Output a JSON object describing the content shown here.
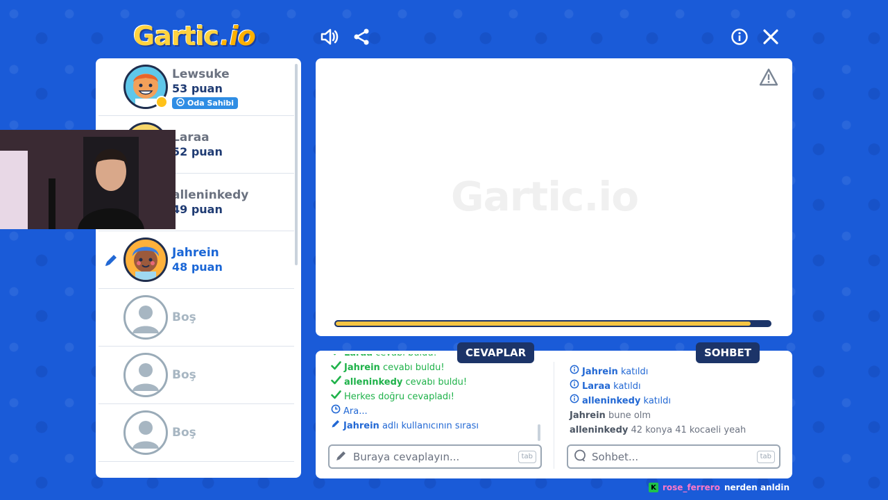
{
  "header": {
    "logo": "Gartic",
    "logo_suffix": ".io",
    "icons": [
      "sound-icon",
      "share-icon",
      "info-icon",
      "close-icon"
    ]
  },
  "players": [
    {
      "name": "Lewsuke",
      "points": "53 puan",
      "badge": "Oda Sahibi",
      "state": "owner"
    },
    {
      "name": "Laraa",
      "points": "52 puan",
      "state": "normal"
    },
    {
      "name": "alleninkedy",
      "points": "49 puan",
      "state": "normal"
    },
    {
      "name": "Jahrein",
      "points": "48 puan",
      "state": "drawing"
    },
    {
      "name": "Boş",
      "state": "empty"
    },
    {
      "name": "Boş",
      "state": "empty"
    },
    {
      "name": "Boş",
      "state": "empty"
    }
  ],
  "canvas": {
    "watermark": "Gartic.io",
    "timer_fraction": 0.955
  },
  "answers": {
    "title": "CEVAPLAR",
    "messages": [
      {
        "type": "ok",
        "user": "Laraa",
        "text": "cevabı buldu!"
      },
      {
        "type": "ok",
        "user": "Jahrein",
        "text": "cevabı buldu!"
      },
      {
        "type": "ok",
        "user": "alleninkedy",
        "text": "cevabı buldu!"
      },
      {
        "type": "ok",
        "user": "",
        "text": "Herkes doğru cevapladı!"
      },
      {
        "type": "clock",
        "user": "",
        "text": "Ara..."
      },
      {
        "type": "pen",
        "user": "Jahrein",
        "text": "adlı kullanıcının sırası"
      }
    ],
    "placeholder": "Buraya cevaplayın...",
    "tab": "tab"
  },
  "chat": {
    "title": "SOHBET",
    "messages": [
      {
        "type": "info",
        "user": "Jahrein",
        "text": "katıldı"
      },
      {
        "type": "info",
        "user": "Laraa",
        "text": "katıldı"
      },
      {
        "type": "info",
        "user": "alleninkedy",
        "text": "katıldı"
      },
      {
        "type": "msg",
        "user": "Jahrein",
        "text": "bune olm"
      },
      {
        "type": "msg",
        "user": "alleninkedy",
        "text": "42 konya 41 kocaeli yeah"
      }
    ],
    "placeholder": "Sohbet...",
    "tab": "tab"
  },
  "twitch": {
    "user": "rose_ferrero",
    "text": "nerden anldin"
  },
  "colors": {
    "background": "#1a5bd8",
    "navy": "#1c3468",
    "accent_blue": "#2268d4",
    "green": "#1fb24a",
    "timer_yellow": "#f5c542"
  }
}
